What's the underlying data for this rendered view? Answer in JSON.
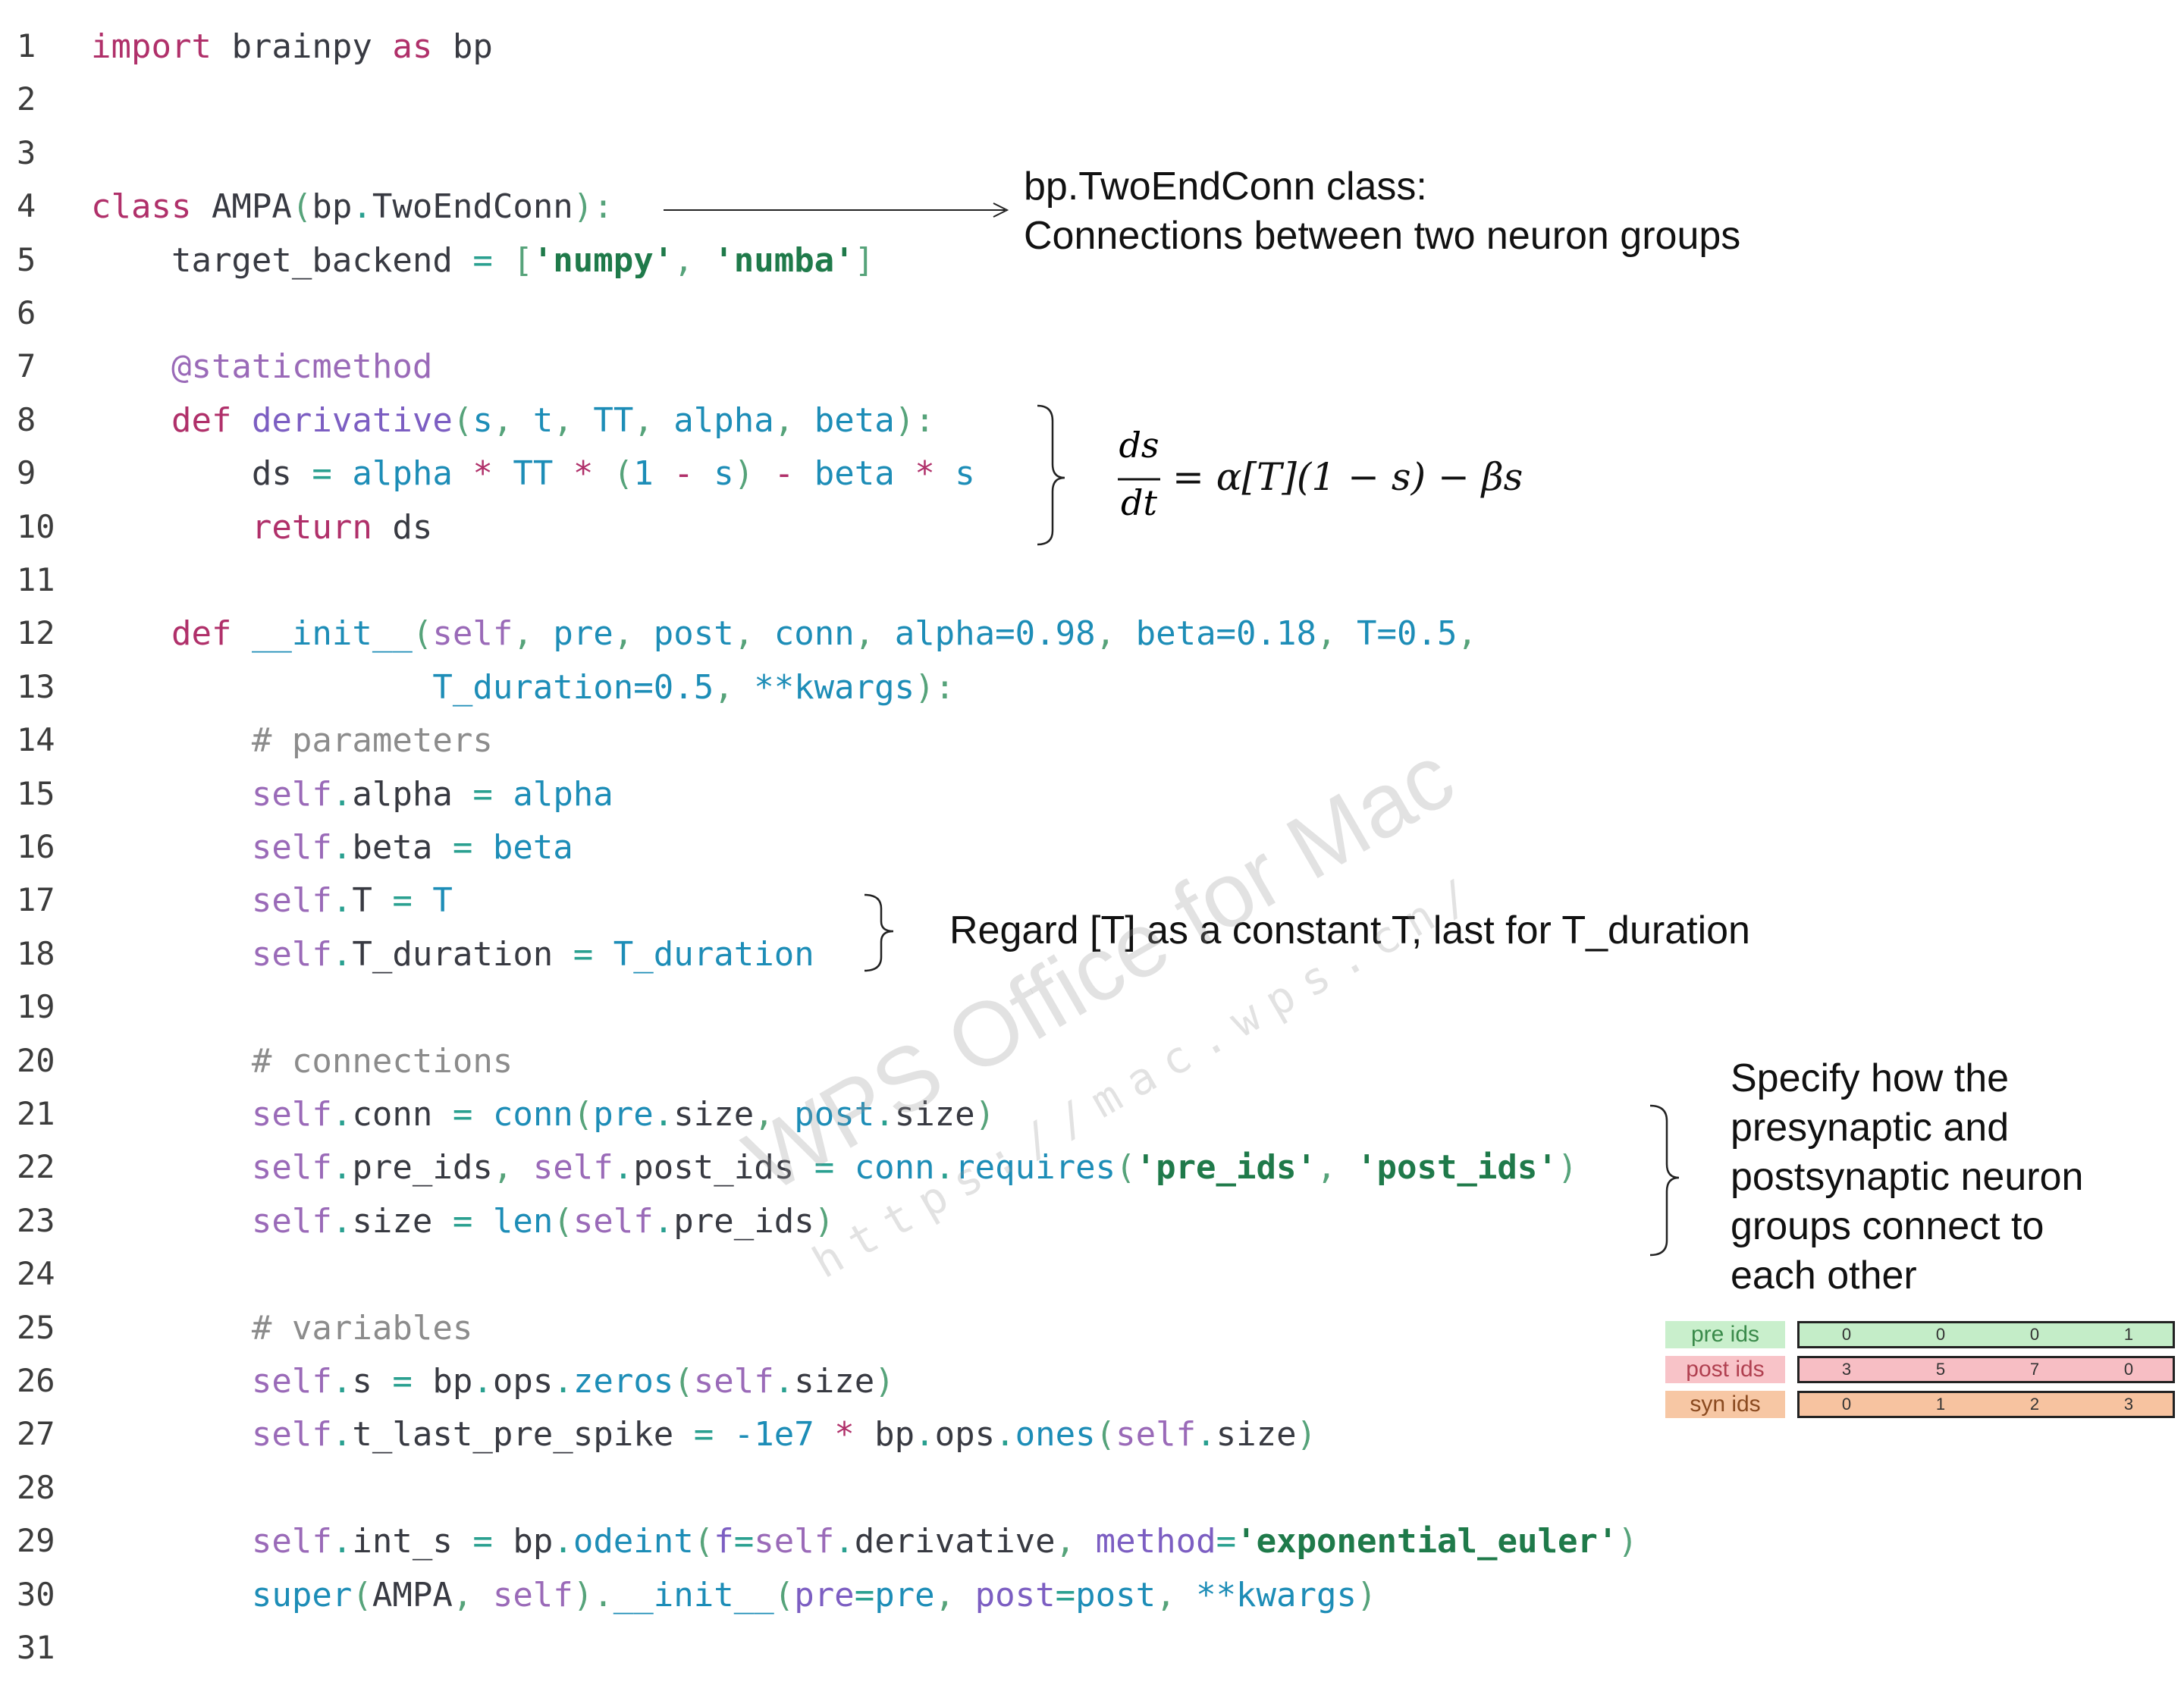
{
  "code_lines": [
    {
      "n": "1",
      "tokens": [
        {
          "t": "import",
          "c": "kw"
        },
        {
          "t": " brainpy ",
          "c": ""
        },
        {
          "t": "as",
          "c": "kw"
        },
        {
          "t": " bp",
          "c": ""
        }
      ]
    },
    {
      "n": "2",
      "tokens": []
    },
    {
      "n": "3",
      "tokens": []
    },
    {
      "n": "4",
      "tokens": [
        {
          "t": "class",
          "c": "kw"
        },
        {
          "t": " AMPA",
          "c": ""
        },
        {
          "t": "(",
          "c": "pn"
        },
        {
          "t": "bp",
          "c": ""
        },
        {
          "t": ".",
          "c": "op"
        },
        {
          "t": "TwoEndConn",
          "c": ""
        },
        {
          "t": "):",
          "c": "pn"
        }
      ]
    },
    {
      "n": "5",
      "tokens": [
        {
          "t": "    target_backend ",
          "c": ""
        },
        {
          "t": "=",
          "c": "op"
        },
        {
          "t": " [",
          "c": "pn"
        },
        {
          "t": "'numpy'",
          "c": "str"
        },
        {
          "t": ", ",
          "c": "pn"
        },
        {
          "t": "'numba'",
          "c": "str"
        },
        {
          "t": "]",
          "c": "pn"
        }
      ]
    },
    {
      "n": "6",
      "tokens": []
    },
    {
      "n": "7",
      "tokens": [
        {
          "t": "    @staticmethod",
          "c": "dec"
        }
      ]
    },
    {
      "n": "8",
      "tokens": [
        {
          "t": "    ",
          "c": ""
        },
        {
          "t": "def",
          "c": "kw"
        },
        {
          "t": " derivative",
          "c": "fn"
        },
        {
          "t": "(",
          "c": "pn"
        },
        {
          "t": "s",
          "c": "bi"
        },
        {
          "t": ", ",
          "c": "pn"
        },
        {
          "t": "t",
          "c": "bi"
        },
        {
          "t": ", ",
          "c": "pn"
        },
        {
          "t": "TT",
          "c": "bi"
        },
        {
          "t": ", ",
          "c": "pn"
        },
        {
          "t": "alpha",
          "c": "bi"
        },
        {
          "t": ", ",
          "c": "pn"
        },
        {
          "t": "beta",
          "c": "bi"
        },
        {
          "t": "):",
          "c": "pn"
        }
      ]
    },
    {
      "n": "9",
      "tokens": [
        {
          "t": "        ds ",
          "c": ""
        },
        {
          "t": "=",
          "c": "op"
        },
        {
          "t": " alpha ",
          "c": "bi"
        },
        {
          "t": "*",
          "c": "kw"
        },
        {
          "t": " TT ",
          "c": "bi"
        },
        {
          "t": "*",
          "c": "kw"
        },
        {
          "t": " (",
          "c": "pn"
        },
        {
          "t": "1",
          "c": "num"
        },
        {
          "t": " - ",
          "c": "kw"
        },
        {
          "t": "s",
          "c": "bi"
        },
        {
          "t": ") ",
          "c": "pn"
        },
        {
          "t": "-",
          "c": "kw"
        },
        {
          "t": " beta ",
          "c": "bi"
        },
        {
          "t": "*",
          "c": "kw"
        },
        {
          "t": " s",
          "c": "bi"
        }
      ]
    },
    {
      "n": "10",
      "tokens": [
        {
          "t": "        ",
          "c": ""
        },
        {
          "t": "return",
          "c": "kw"
        },
        {
          "t": " ds",
          "c": ""
        }
      ]
    },
    {
      "n": "11",
      "tokens": []
    },
    {
      "n": "12",
      "tokens": [
        {
          "t": "    ",
          "c": ""
        },
        {
          "t": "def",
          "c": "kw"
        },
        {
          "t": " __init__",
          "c": "bi"
        },
        {
          "t": "(",
          "c": "pn"
        },
        {
          "t": "self",
          "c": "slf"
        },
        {
          "t": ", ",
          "c": "pn"
        },
        {
          "t": "pre",
          "c": "bi"
        },
        {
          "t": ", ",
          "c": "pn"
        },
        {
          "t": "post",
          "c": "bi"
        },
        {
          "t": ", ",
          "c": "pn"
        },
        {
          "t": "conn",
          "c": "bi"
        },
        {
          "t": ", ",
          "c": "pn"
        },
        {
          "t": "alpha=0.98",
          "c": "bi"
        },
        {
          "t": ", ",
          "c": "pn"
        },
        {
          "t": "beta=0.18",
          "c": "bi"
        },
        {
          "t": ", ",
          "c": "pn"
        },
        {
          "t": "T=0.5",
          "c": "bi"
        },
        {
          "t": ",",
          "c": "pn"
        }
      ]
    },
    {
      "n": "13",
      "tokens": [
        {
          "t": "                 ",
          "c": ""
        },
        {
          "t": "T_duration=0.5",
          "c": "bi"
        },
        {
          "t": ", ",
          "c": "pn"
        },
        {
          "t": "**kwargs",
          "c": "bi"
        },
        {
          "t": "):",
          "c": "pn"
        }
      ]
    },
    {
      "n": "14",
      "tokens": [
        {
          "t": "        # parameters",
          "c": "cm"
        }
      ]
    },
    {
      "n": "15",
      "tokens": [
        {
          "t": "        ",
          "c": ""
        },
        {
          "t": "self",
          "c": "slf"
        },
        {
          "t": ".",
          "c": "op"
        },
        {
          "t": "alpha ",
          "c": ""
        },
        {
          "t": "=",
          "c": "op"
        },
        {
          "t": " alpha",
          "c": "bi"
        }
      ]
    },
    {
      "n": "16",
      "tokens": [
        {
          "t": "        ",
          "c": ""
        },
        {
          "t": "self",
          "c": "slf"
        },
        {
          "t": ".",
          "c": "op"
        },
        {
          "t": "beta ",
          "c": ""
        },
        {
          "t": "=",
          "c": "op"
        },
        {
          "t": " beta",
          "c": "bi"
        }
      ]
    },
    {
      "n": "17",
      "tokens": [
        {
          "t": "        ",
          "c": ""
        },
        {
          "t": "self",
          "c": "slf"
        },
        {
          "t": ".",
          "c": "op"
        },
        {
          "t": "T ",
          "c": ""
        },
        {
          "t": "=",
          "c": "op"
        },
        {
          "t": " T",
          "c": "bi"
        }
      ]
    },
    {
      "n": "18",
      "tokens": [
        {
          "t": "        ",
          "c": ""
        },
        {
          "t": "self",
          "c": "slf"
        },
        {
          "t": ".",
          "c": "op"
        },
        {
          "t": "T_duration ",
          "c": ""
        },
        {
          "t": "=",
          "c": "op"
        },
        {
          "t": " T_duration",
          "c": "bi"
        }
      ]
    },
    {
      "n": "19",
      "tokens": []
    },
    {
      "n": "20",
      "tokens": [
        {
          "t": "        # connections",
          "c": "cm"
        }
      ]
    },
    {
      "n": "21",
      "tokens": [
        {
          "t": "        ",
          "c": ""
        },
        {
          "t": "self",
          "c": "slf"
        },
        {
          "t": ".",
          "c": "op"
        },
        {
          "t": "conn ",
          "c": ""
        },
        {
          "t": "=",
          "c": "op"
        },
        {
          "t": " conn",
          "c": "bi"
        },
        {
          "t": "(",
          "c": "pn"
        },
        {
          "t": "pre",
          "c": "bi"
        },
        {
          "t": ".",
          "c": "op"
        },
        {
          "t": "size",
          "c": ""
        },
        {
          "t": ", ",
          "c": "pn"
        },
        {
          "t": "post",
          "c": "bi"
        },
        {
          "t": ".",
          "c": "op"
        },
        {
          "t": "size",
          "c": ""
        },
        {
          "t": ")",
          "c": "pn"
        }
      ]
    },
    {
      "n": "22",
      "tokens": [
        {
          "t": "        ",
          "c": ""
        },
        {
          "t": "self",
          "c": "slf"
        },
        {
          "t": ".",
          "c": "op"
        },
        {
          "t": "pre_ids",
          "c": ""
        },
        {
          "t": ", ",
          "c": "pn"
        },
        {
          "t": "self",
          "c": "slf"
        },
        {
          "t": ".",
          "c": "op"
        },
        {
          "t": "post_ids ",
          "c": ""
        },
        {
          "t": "=",
          "c": "op"
        },
        {
          "t": " conn",
          "c": "bi"
        },
        {
          "t": ".",
          "c": "op"
        },
        {
          "t": "requires",
          "c": "bi"
        },
        {
          "t": "(",
          "c": "pn"
        },
        {
          "t": "'pre_ids'",
          "c": "str"
        },
        {
          "t": ", ",
          "c": "pn"
        },
        {
          "t": "'post_ids'",
          "c": "str"
        },
        {
          "t": ")",
          "c": "pn"
        }
      ]
    },
    {
      "n": "23",
      "tokens": [
        {
          "t": "        ",
          "c": ""
        },
        {
          "t": "self",
          "c": "slf"
        },
        {
          "t": ".",
          "c": "op"
        },
        {
          "t": "size ",
          "c": ""
        },
        {
          "t": "=",
          "c": "op"
        },
        {
          "t": " len",
          "c": "bi"
        },
        {
          "t": "(",
          "c": "pn"
        },
        {
          "t": "self",
          "c": "slf"
        },
        {
          "t": ".",
          "c": "op"
        },
        {
          "t": "pre_ids",
          "c": ""
        },
        {
          "t": ")",
          "c": "pn"
        }
      ]
    },
    {
      "n": "24",
      "tokens": []
    },
    {
      "n": "25",
      "tokens": [
        {
          "t": "        # variables",
          "c": "cm"
        }
      ]
    },
    {
      "n": "26",
      "tokens": [
        {
          "t": "        ",
          "c": ""
        },
        {
          "t": "self",
          "c": "slf"
        },
        {
          "t": ".",
          "c": "op"
        },
        {
          "t": "s ",
          "c": ""
        },
        {
          "t": "=",
          "c": "op"
        },
        {
          "t": " bp",
          "c": ""
        },
        {
          "t": ".",
          "c": "op"
        },
        {
          "t": "ops",
          "c": ""
        },
        {
          "t": ".",
          "c": "op"
        },
        {
          "t": "zeros",
          "c": "bi"
        },
        {
          "t": "(",
          "c": "pn"
        },
        {
          "t": "self",
          "c": "slf"
        },
        {
          "t": ".",
          "c": "op"
        },
        {
          "t": "size",
          "c": ""
        },
        {
          "t": ")",
          "c": "pn"
        }
      ]
    },
    {
      "n": "27",
      "tokens": [
        {
          "t": "        ",
          "c": ""
        },
        {
          "t": "self",
          "c": "slf"
        },
        {
          "t": ".",
          "c": "op"
        },
        {
          "t": "t_last_pre_spike ",
          "c": ""
        },
        {
          "t": "=",
          "c": "op"
        },
        {
          "t": " -1e7 ",
          "c": "num"
        },
        {
          "t": "*",
          "c": "kw"
        },
        {
          "t": " bp",
          "c": ""
        },
        {
          "t": ".",
          "c": "op"
        },
        {
          "t": "ops",
          "c": ""
        },
        {
          "t": ".",
          "c": "op"
        },
        {
          "t": "ones",
          "c": "bi"
        },
        {
          "t": "(",
          "c": "pn"
        },
        {
          "t": "self",
          "c": "slf"
        },
        {
          "t": ".",
          "c": "op"
        },
        {
          "t": "size",
          "c": ""
        },
        {
          "t": ")",
          "c": "pn"
        }
      ]
    },
    {
      "n": "28",
      "tokens": []
    },
    {
      "n": "29",
      "tokens": [
        {
          "t": "        ",
          "c": ""
        },
        {
          "t": "self",
          "c": "slf"
        },
        {
          "t": ".",
          "c": "op"
        },
        {
          "t": "int_s ",
          "c": ""
        },
        {
          "t": "=",
          "c": "op"
        },
        {
          "t": " bp",
          "c": ""
        },
        {
          "t": ".",
          "c": "op"
        },
        {
          "t": "odeint",
          "c": "bi"
        },
        {
          "t": "(",
          "c": "pn"
        },
        {
          "t": "f",
          "c": "fn"
        },
        {
          "t": "=",
          "c": "op"
        },
        {
          "t": "self",
          "c": "slf"
        },
        {
          "t": ".",
          "c": "op"
        },
        {
          "t": "derivative",
          "c": ""
        },
        {
          "t": ", ",
          "c": "pn"
        },
        {
          "t": "method",
          "c": "fn"
        },
        {
          "t": "=",
          "c": "op"
        },
        {
          "t": "'exponential_euler'",
          "c": "str"
        },
        {
          "t": ")",
          "c": "pn"
        }
      ]
    },
    {
      "n": "30",
      "tokens": [
        {
          "t": "        ",
          "c": ""
        },
        {
          "t": "super",
          "c": "bi"
        },
        {
          "t": "(",
          "c": "pn"
        },
        {
          "t": "AMPA",
          "c": ""
        },
        {
          "t": ", ",
          "c": "pn"
        },
        {
          "t": "self",
          "c": "slf"
        },
        {
          "t": ").",
          "c": "pn"
        },
        {
          "t": "__init__",
          "c": "bi"
        },
        {
          "t": "(",
          "c": "pn"
        },
        {
          "t": "pre",
          "c": "fn"
        },
        {
          "t": "=",
          "c": "op"
        },
        {
          "t": "pre",
          "c": "bi"
        },
        {
          "t": ", ",
          "c": "pn"
        },
        {
          "t": "post",
          "c": "fn"
        },
        {
          "t": "=",
          "c": "op"
        },
        {
          "t": "post",
          "c": "bi"
        },
        {
          "t": ", ",
          "c": "pn"
        },
        {
          "t": "**kwargs",
          "c": "bi"
        },
        {
          "t": ")",
          "c": "pn"
        }
      ]
    },
    {
      "n": "31",
      "tokens": []
    }
  ],
  "annotations": {
    "twoendconn": {
      "line1": "bp.TwoEndConn class:",
      "line2": "Connections between two neuron groups"
    },
    "equation": {
      "numerator": "ds",
      "denominator": "dt",
      "rhs": "= α[T](1 − s) − βs"
    },
    "constant": {
      "text": "Regard [T] as a constant T, last for T_duration"
    },
    "connect": {
      "lines": [
        "Specify how the",
        "presynaptic and",
        "postsynaptic neuron",
        "groups connect to",
        "each other"
      ]
    }
  },
  "id_table": {
    "rows": [
      {
        "label": "pre ids",
        "values": [
          "0",
          "0",
          "0",
          "1"
        ],
        "label_color": "#c9efcc",
        "row_color": "#c4edc8",
        "text_color": "#3a8a4a"
      },
      {
        "label": "post ids",
        "values": [
          "3",
          "5",
          "7",
          "0"
        ],
        "label_color": "#f8c3c8",
        "row_color": "#f7bec4",
        "text_color": "#b04050"
      },
      {
        "label": "syn ids",
        "values": [
          "0",
          "1",
          "2",
          "3"
        ],
        "label_color": "#f7c7a4",
        "row_color": "#f7c3a0",
        "text_color": "#8a4a20"
      }
    ]
  },
  "watermark": {
    "title": "WPS Office for Mac",
    "url": "https://mac.wps.cn/"
  }
}
